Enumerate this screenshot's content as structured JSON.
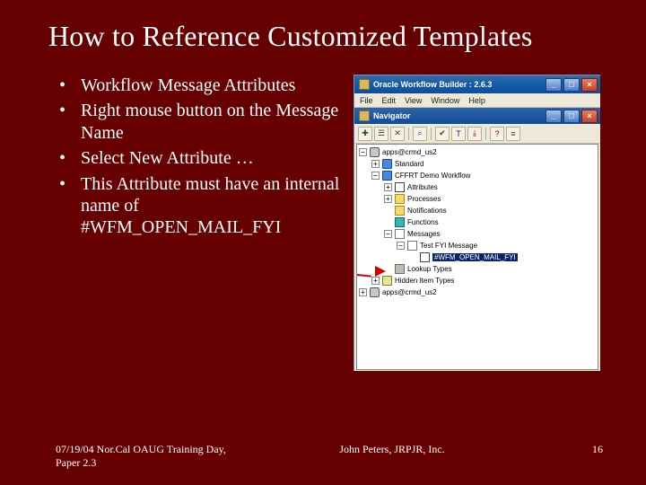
{
  "title": "How to Reference Customized Templates",
  "bullets": [
    "Workflow Message Attributes",
    "Right mouse button on the Message Name",
    "Select New Attribute …",
    "This Attribute must have an internal name of #WFM_OPEN_MAIL_FYI"
  ],
  "footer": {
    "left": "07/19/04 Nor.Cal OAUG Training Day, Paper 2.3",
    "center": "John Peters, JRPJR, Inc.",
    "page": "16"
  },
  "app": {
    "window_title": "Oracle Workflow Builder : 2.6.3",
    "menus": [
      "File",
      "Edit",
      "View",
      "Window",
      "Help"
    ],
    "nav_title": "Navigator",
    "win_min": "_",
    "win_max": "□",
    "win_close": "×",
    "tree": {
      "root": "apps@crmd_us2",
      "wf_std": "Standard",
      "wf_demo": "CFFRT Demo Workflow",
      "n_attr": "Attributes",
      "n_proc": "Processes",
      "n_notif": "Notifications",
      "n_func": "Functions",
      "n_msgs": "Messages",
      "msg_1": "Test FYI Message",
      "msg_sel": "#WFM_OPEN_MAIL_FYI",
      "n_look": "Lookup Types",
      "n_hide": "Hidden Item Types",
      "root2": "apps@crmd_us2"
    }
  }
}
